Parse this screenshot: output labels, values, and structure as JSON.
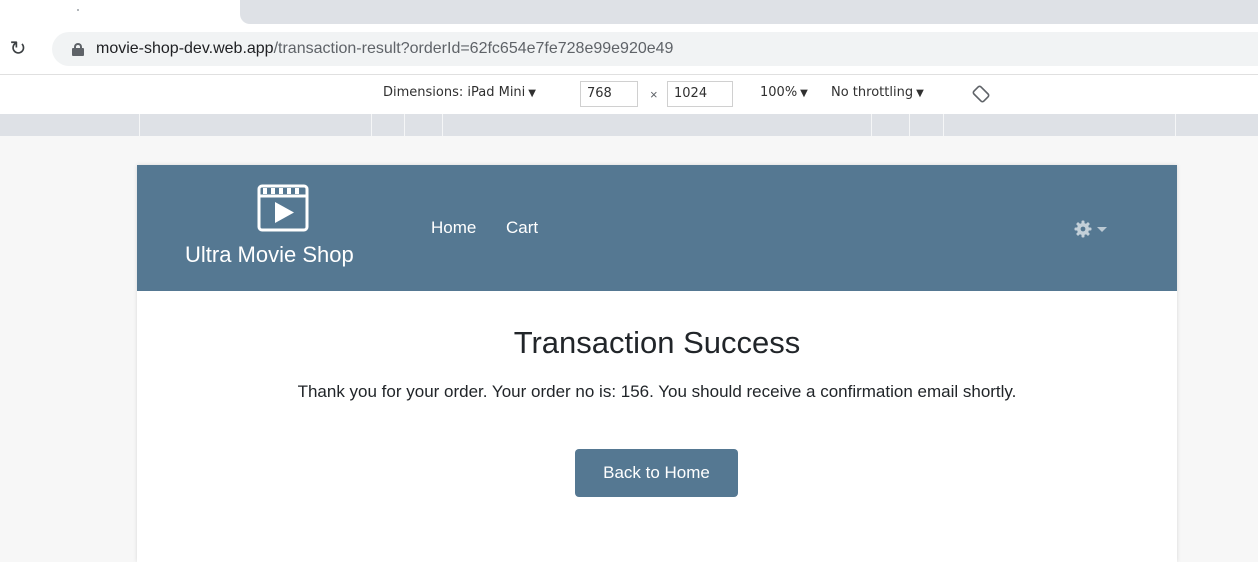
{
  "browser": {
    "url_host": "movie-shop-dev.web.app",
    "url_path": "/transaction-result?orderId=62fc654e7fe728e99e920e49"
  },
  "devtools": {
    "dimensions_label": "Dimensions: iPad Mini",
    "width": "768",
    "times": "×",
    "height": "1024",
    "zoom": "100%",
    "throttling": "No throttling",
    "dropdown_glyph": "▼"
  },
  "app": {
    "brand_name": "Ultra Movie Shop",
    "brand_icon": "clapperboard-icon",
    "nav": {
      "home": "Home",
      "cart": "Cart"
    },
    "settings_icon": "gear-icon",
    "accent_color": "#557892"
  },
  "transaction": {
    "title": "Transaction Success",
    "message": "Thank you for your order. Your order no is: 156. You should receive a confirmation email shortly.",
    "back_button": "Back to Home"
  }
}
